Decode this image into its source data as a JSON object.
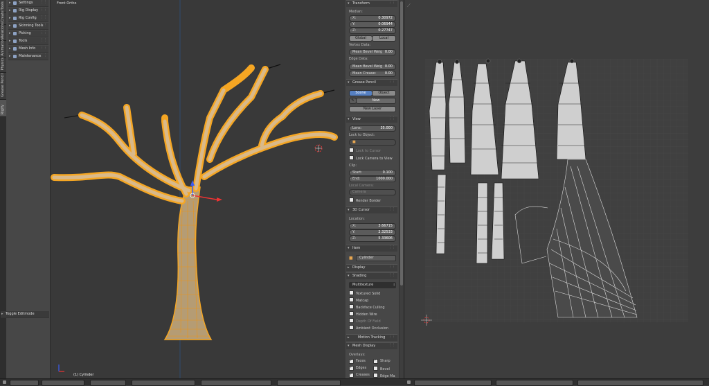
{
  "tabstrip": {
    "tabs": [
      "Tools",
      "Create",
      "Relations",
      "Animation",
      "Physics",
      "Grease Pencil",
      "Shading / UVs",
      "Options",
      "Rigify"
    ]
  },
  "toolshelf": {
    "items": [
      "Settings",
      "Rig Display",
      "Rig Config",
      "Skinning Tools",
      "Picking",
      "Tools",
      "Mesh Info",
      "Maintenance"
    ],
    "footer": "Toggle Editmode"
  },
  "viewport": {
    "title": "Front Ortho",
    "status": "(1) Cylinder"
  },
  "npanel": {
    "transform": {
      "header": "Transform",
      "median_label": "Median:",
      "x_key": "X:",
      "x_val": "0.30972",
      "y_key": "Y:",
      "y_val": "0.06944",
      "z_key": "Z:",
      "z_val": "0.27747",
      "global": "Global",
      "local": "Local",
      "vertex_data": "Vertex Data:",
      "mean_bevel_weight_v": "Mean Bevel Weig",
      "mean_bevel_weight_v_val": "0.00",
      "edge_data": "Edge Data:",
      "mean_bevel_weight_e": "Mean Bevel Weig",
      "mean_bevel_weight_e_val": "0.00",
      "mean_crease": "Mean Crease:",
      "mean_crease_val": "0.00"
    },
    "grease_pencil": {
      "header": "Grease Pencil",
      "scene": "Scene",
      "object": "Object",
      "new": "New",
      "new_layer": "New Layer"
    },
    "view": {
      "header": "View",
      "lens_key": "Lens:",
      "lens_val": "35.000",
      "lock_to_object": "Lock to Object:",
      "lock_to_cursor": "Lock to Cursor",
      "lock_camera_to_view": "Lock Camera to View",
      "clip": "Clip:",
      "start_key": "Start:",
      "start_val": "0.100",
      "end_key": "End:",
      "end_val": "1000.000",
      "local_camera": "Local Camera:",
      "camera": "Camera",
      "render_border": "Render Border"
    },
    "cursor": {
      "header": "3D Cursor",
      "location": "Location:",
      "x_key": "X:",
      "x_val": "3.66715",
      "y_key": "Y:",
      "y_val": "2.32533",
      "z_key": "Z:",
      "z_val": "5.33606"
    },
    "item": {
      "header": "Item",
      "name": "Cylinder"
    },
    "display": {
      "header": "Display"
    },
    "shading": {
      "header": "Shading",
      "mode": "Multitexture",
      "textured_solid": "Textured Solid",
      "matcap": "Matcap",
      "backface_culling": "Backface Culling",
      "hidden_wire": "Hidden Wire",
      "depth_of_field": "Depth Of Field",
      "ambient_occlusion": "Ambient Occlusion"
    },
    "motion_tracking": {
      "header": "Motion Tracking"
    },
    "mesh_display": {
      "header": "Mesh Display",
      "overlays": "Overlays:",
      "faces": "Faces",
      "sharp": "Sharp",
      "edges": "Edges",
      "bevel": "Bevel",
      "creases": "Creases",
      "edge_ma": "Edge Ma"
    }
  },
  "colors": {
    "selection_orange": "#f5a623",
    "accent_blue": "#5680c2",
    "viewport_bg": "#393939",
    "panel_bg": "#474747"
  }
}
